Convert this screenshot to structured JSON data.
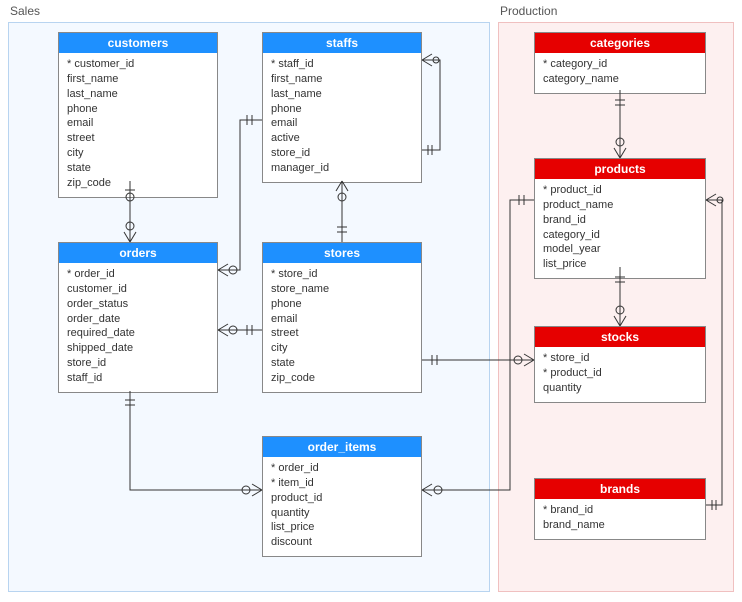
{
  "diagram_type": "entity-relationship",
  "schemas": {
    "sales": {
      "label": "Sales"
    },
    "production": {
      "label": "Production"
    }
  },
  "tables": {
    "customers": {
      "title": "customers",
      "columns": [
        "* customer_id",
        "first_name",
        "last_name",
        "phone",
        "email",
        "street",
        "city",
        "state",
        "zip_code"
      ]
    },
    "staffs": {
      "title": "staffs",
      "columns": [
        "* staff_id",
        "first_name",
        "last_name",
        "phone",
        "email",
        "active",
        "store_id",
        "manager_id"
      ]
    },
    "orders": {
      "title": "orders",
      "columns": [
        "* order_id",
        "customer_id",
        "order_status",
        "order_date",
        "required_date",
        "shipped_date",
        "store_id",
        "staff_id"
      ]
    },
    "stores": {
      "title": "stores",
      "columns": [
        "* store_id",
        "store_name",
        "phone",
        "email",
        "street",
        "city",
        "state",
        "zip_code"
      ]
    },
    "order_items": {
      "title": "order_items",
      "columns": [
        "* order_id",
        "* item_id",
        "product_id",
        "quantity",
        "list_price",
        "discount"
      ]
    },
    "categories": {
      "title": "categories",
      "columns": [
        "* category_id",
        "category_name"
      ]
    },
    "products": {
      "title": "products",
      "columns": [
        "* product_id",
        "product_name",
        "brand_id",
        "category_id",
        "model_year",
        "list_price"
      ]
    },
    "stocks": {
      "title": "stocks",
      "columns": [
        "* store_id",
        "* product_id",
        "quantity"
      ]
    },
    "brands": {
      "title": "brands",
      "columns": [
        "* brand_id",
        "brand_name"
      ]
    }
  },
  "relationships": [
    {
      "from": "customers",
      "to": "orders",
      "type": "one-to-many"
    },
    {
      "from": "staffs",
      "to": "orders",
      "type": "one-to-many"
    },
    {
      "from": "staffs",
      "to": "staffs",
      "type": "self-one-to-many"
    },
    {
      "from": "stores",
      "to": "staffs",
      "type": "one-to-many"
    },
    {
      "from": "stores",
      "to": "orders",
      "type": "one-to-many"
    },
    {
      "from": "orders",
      "to": "order_items",
      "type": "one-to-many"
    },
    {
      "from": "stores",
      "to": "stocks",
      "type": "one-to-many"
    },
    {
      "from": "products",
      "to": "order_items",
      "type": "one-to-many"
    },
    {
      "from": "products",
      "to": "stocks",
      "type": "one-to-many"
    },
    {
      "from": "categories",
      "to": "products",
      "type": "one-to-many"
    },
    {
      "from": "brands",
      "to": "products",
      "type": "one-to-many"
    }
  ]
}
